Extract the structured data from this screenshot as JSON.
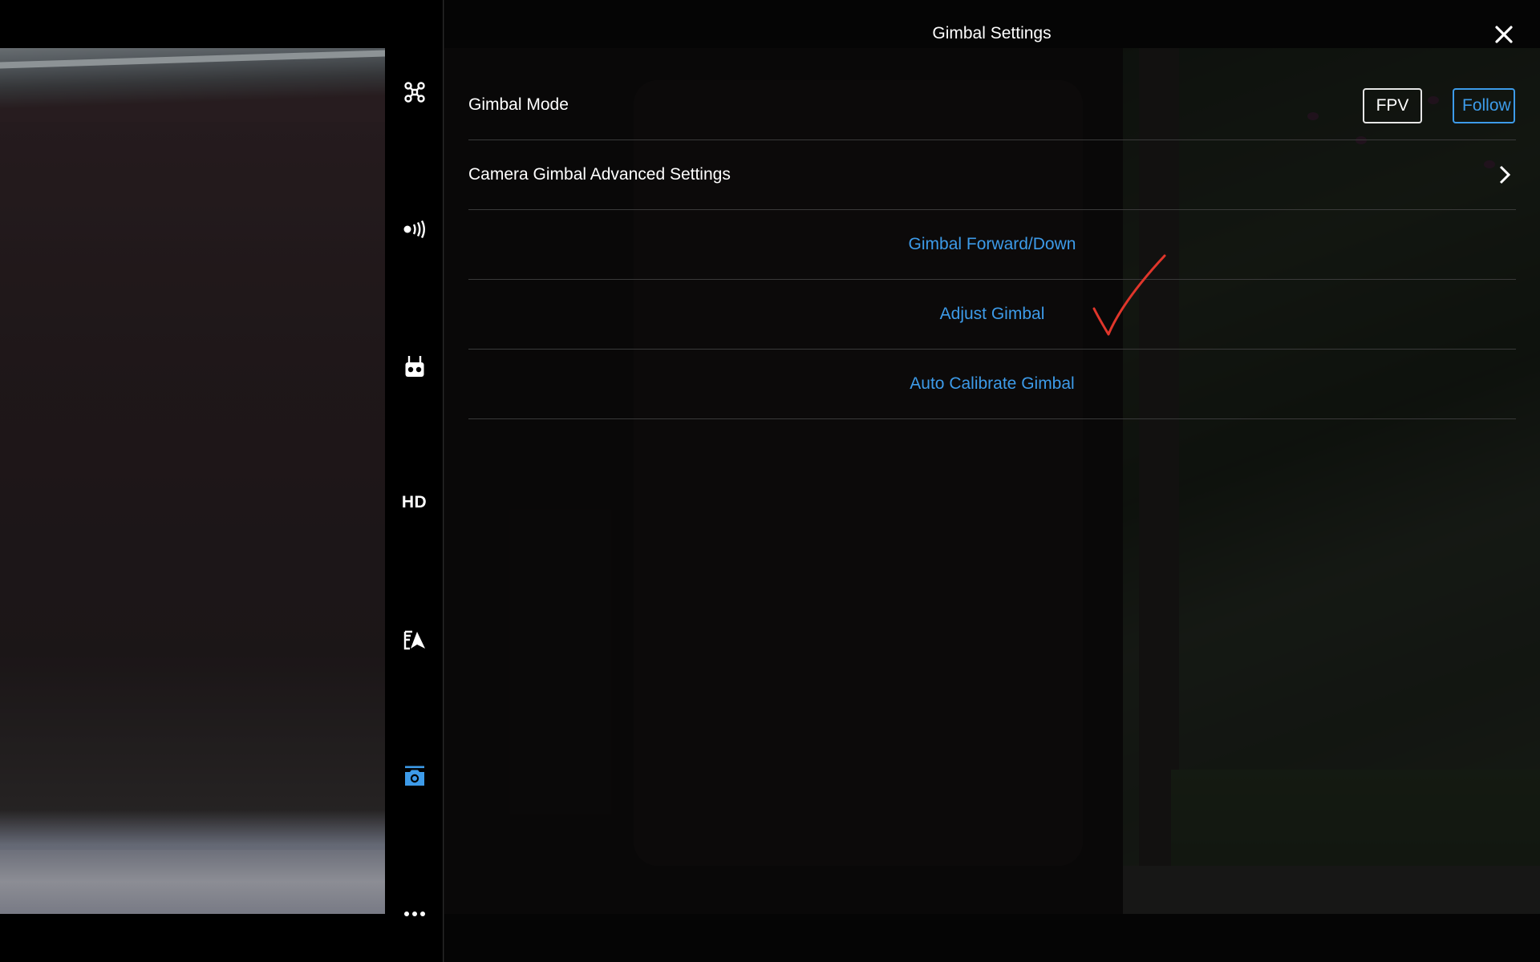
{
  "header": {
    "title": "Gimbal Settings",
    "close_icon": "close-icon"
  },
  "rail": {
    "items": [
      {
        "icon": "aircraft-icon",
        "active": false
      },
      {
        "icon": "signal-icon",
        "active": false
      },
      {
        "icon": "remote-controller-icon",
        "active": false
      },
      {
        "label": "HD",
        "active": false
      },
      {
        "icon": "map-navigation-icon",
        "active": false
      },
      {
        "icon": "gimbal-camera-icon",
        "active": true
      },
      {
        "icon": "more-icon",
        "active": false
      }
    ],
    "active_color": "#3d9be9"
  },
  "gimbal_mode": {
    "label": "Gimbal Mode",
    "options": [
      "FPV",
      "Follow"
    ],
    "selected": "Follow"
  },
  "advanced": {
    "label": "Camera Gimbal Advanced Settings"
  },
  "actions": {
    "forward_down": "Gimbal Forward/Down",
    "adjust": "Adjust Gimbal",
    "auto_calibrate": "Auto Calibrate Gimbal"
  },
  "colors": {
    "accent": "#3d9be9",
    "annotation": "#e0362b"
  }
}
